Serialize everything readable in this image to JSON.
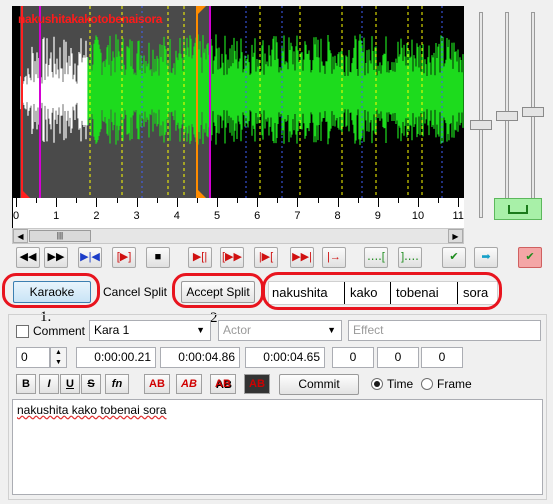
{
  "waveform": {
    "overlay_label": "nakushitakakotobenaisora",
    "timeline_ticks": [
      "0",
      "1",
      "2",
      "3",
      "4",
      "5",
      "6",
      "7",
      "8",
      "9",
      "10",
      "11"
    ],
    "scroll_thumb_glyph": "|||",
    "scroll_left_glyph": "◀",
    "scroll_right_glyph": "▶",
    "colors": {
      "selected_wave": "#1ddb1d",
      "unselected_wave": "#ffffff",
      "background": "#000000",
      "keyframe_line": "#ffff00",
      "marker_start": "#d400d4",
      "marker_end": "#ff8c00"
    }
  },
  "toolbar": {
    "buttons": [
      {
        "name": "play-prev-button",
        "glyph": "◀◀"
      },
      {
        "name": "play-next-button",
        "glyph": "▶▶"
      },
      {
        "name": "play-selection-button",
        "glyph": "▶|◀"
      },
      {
        "name": "play-original-button",
        "glyph": "[▶]"
      },
      {
        "name": "stop-button",
        "glyph": "■"
      },
      {
        "name": "play-before-button",
        "glyph": "▶[|"
      },
      {
        "name": "play-first-500-button",
        "glyph": "[▶▶"
      },
      {
        "name": "play-last-500-button",
        "glyph": "|▶["
      },
      {
        "name": "play-after-button",
        "glyph": "▶▶|"
      },
      {
        "name": "play-to-end-button",
        "glyph": "|→"
      },
      {
        "name": "lead-in-button",
        "glyph": "‥‥["
      },
      {
        "name": "lead-out-button",
        "glyph": "]‥‥"
      },
      {
        "name": "commit-check-button",
        "glyph": "✔"
      },
      {
        "name": "next-line-button",
        "glyph": "➡"
      },
      {
        "name": "auto-commit-button",
        "glyph": "✔"
      }
    ]
  },
  "karaoke": {
    "karaoke_label": "Karaoke",
    "cancel_split_label": "Cancel Split",
    "accept_split_label": "Accept Split",
    "syllables": [
      "nakushita",
      "kako",
      "tobenai",
      "sora"
    ],
    "annotation_1": "1.",
    "annotation_2": "2."
  },
  "edit": {
    "comment_label": "Comment",
    "style_value": "Kara 1",
    "actor_placeholder": "Actor",
    "effect_placeholder": "Effect",
    "layer_value": "0",
    "start_time": "0:00:00.21",
    "end_time": "0:00:04.86",
    "duration": "0:00:04.65",
    "margin_left": "0",
    "margin_right": "0",
    "margin_vertical": "0",
    "bold_label": "B",
    "italic_label": "I",
    "underline_label": "U",
    "strike_label": "S",
    "fn_label": "fn",
    "color1_label": "AB",
    "color2_label": "AB",
    "color3_label": "AB",
    "color4_label": "AB",
    "commit_label": "Commit",
    "time_label": "Time",
    "frame_label": "Frame",
    "text_content": "nakushita kako tobenai sora"
  }
}
